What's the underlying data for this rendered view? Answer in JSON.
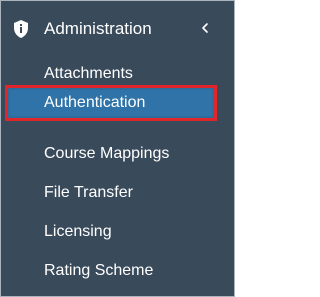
{
  "section": {
    "title": "Administration",
    "icon": "shield-icon",
    "collapse_icon": "chevron-left-icon"
  },
  "menu": {
    "items": [
      {
        "label": "Attachments",
        "active": false
      },
      {
        "label": "Authentication",
        "active": true
      },
      {
        "label": "Course Mappings",
        "active": false
      },
      {
        "label": "File Transfer",
        "active": false
      },
      {
        "label": "Licensing",
        "active": false
      },
      {
        "label": "Rating Scheme",
        "active": false
      }
    ]
  },
  "colors": {
    "background": "#394a5b",
    "active_item": "#2f73a8",
    "active_border": "#e0252b",
    "text": "#ffffff"
  }
}
